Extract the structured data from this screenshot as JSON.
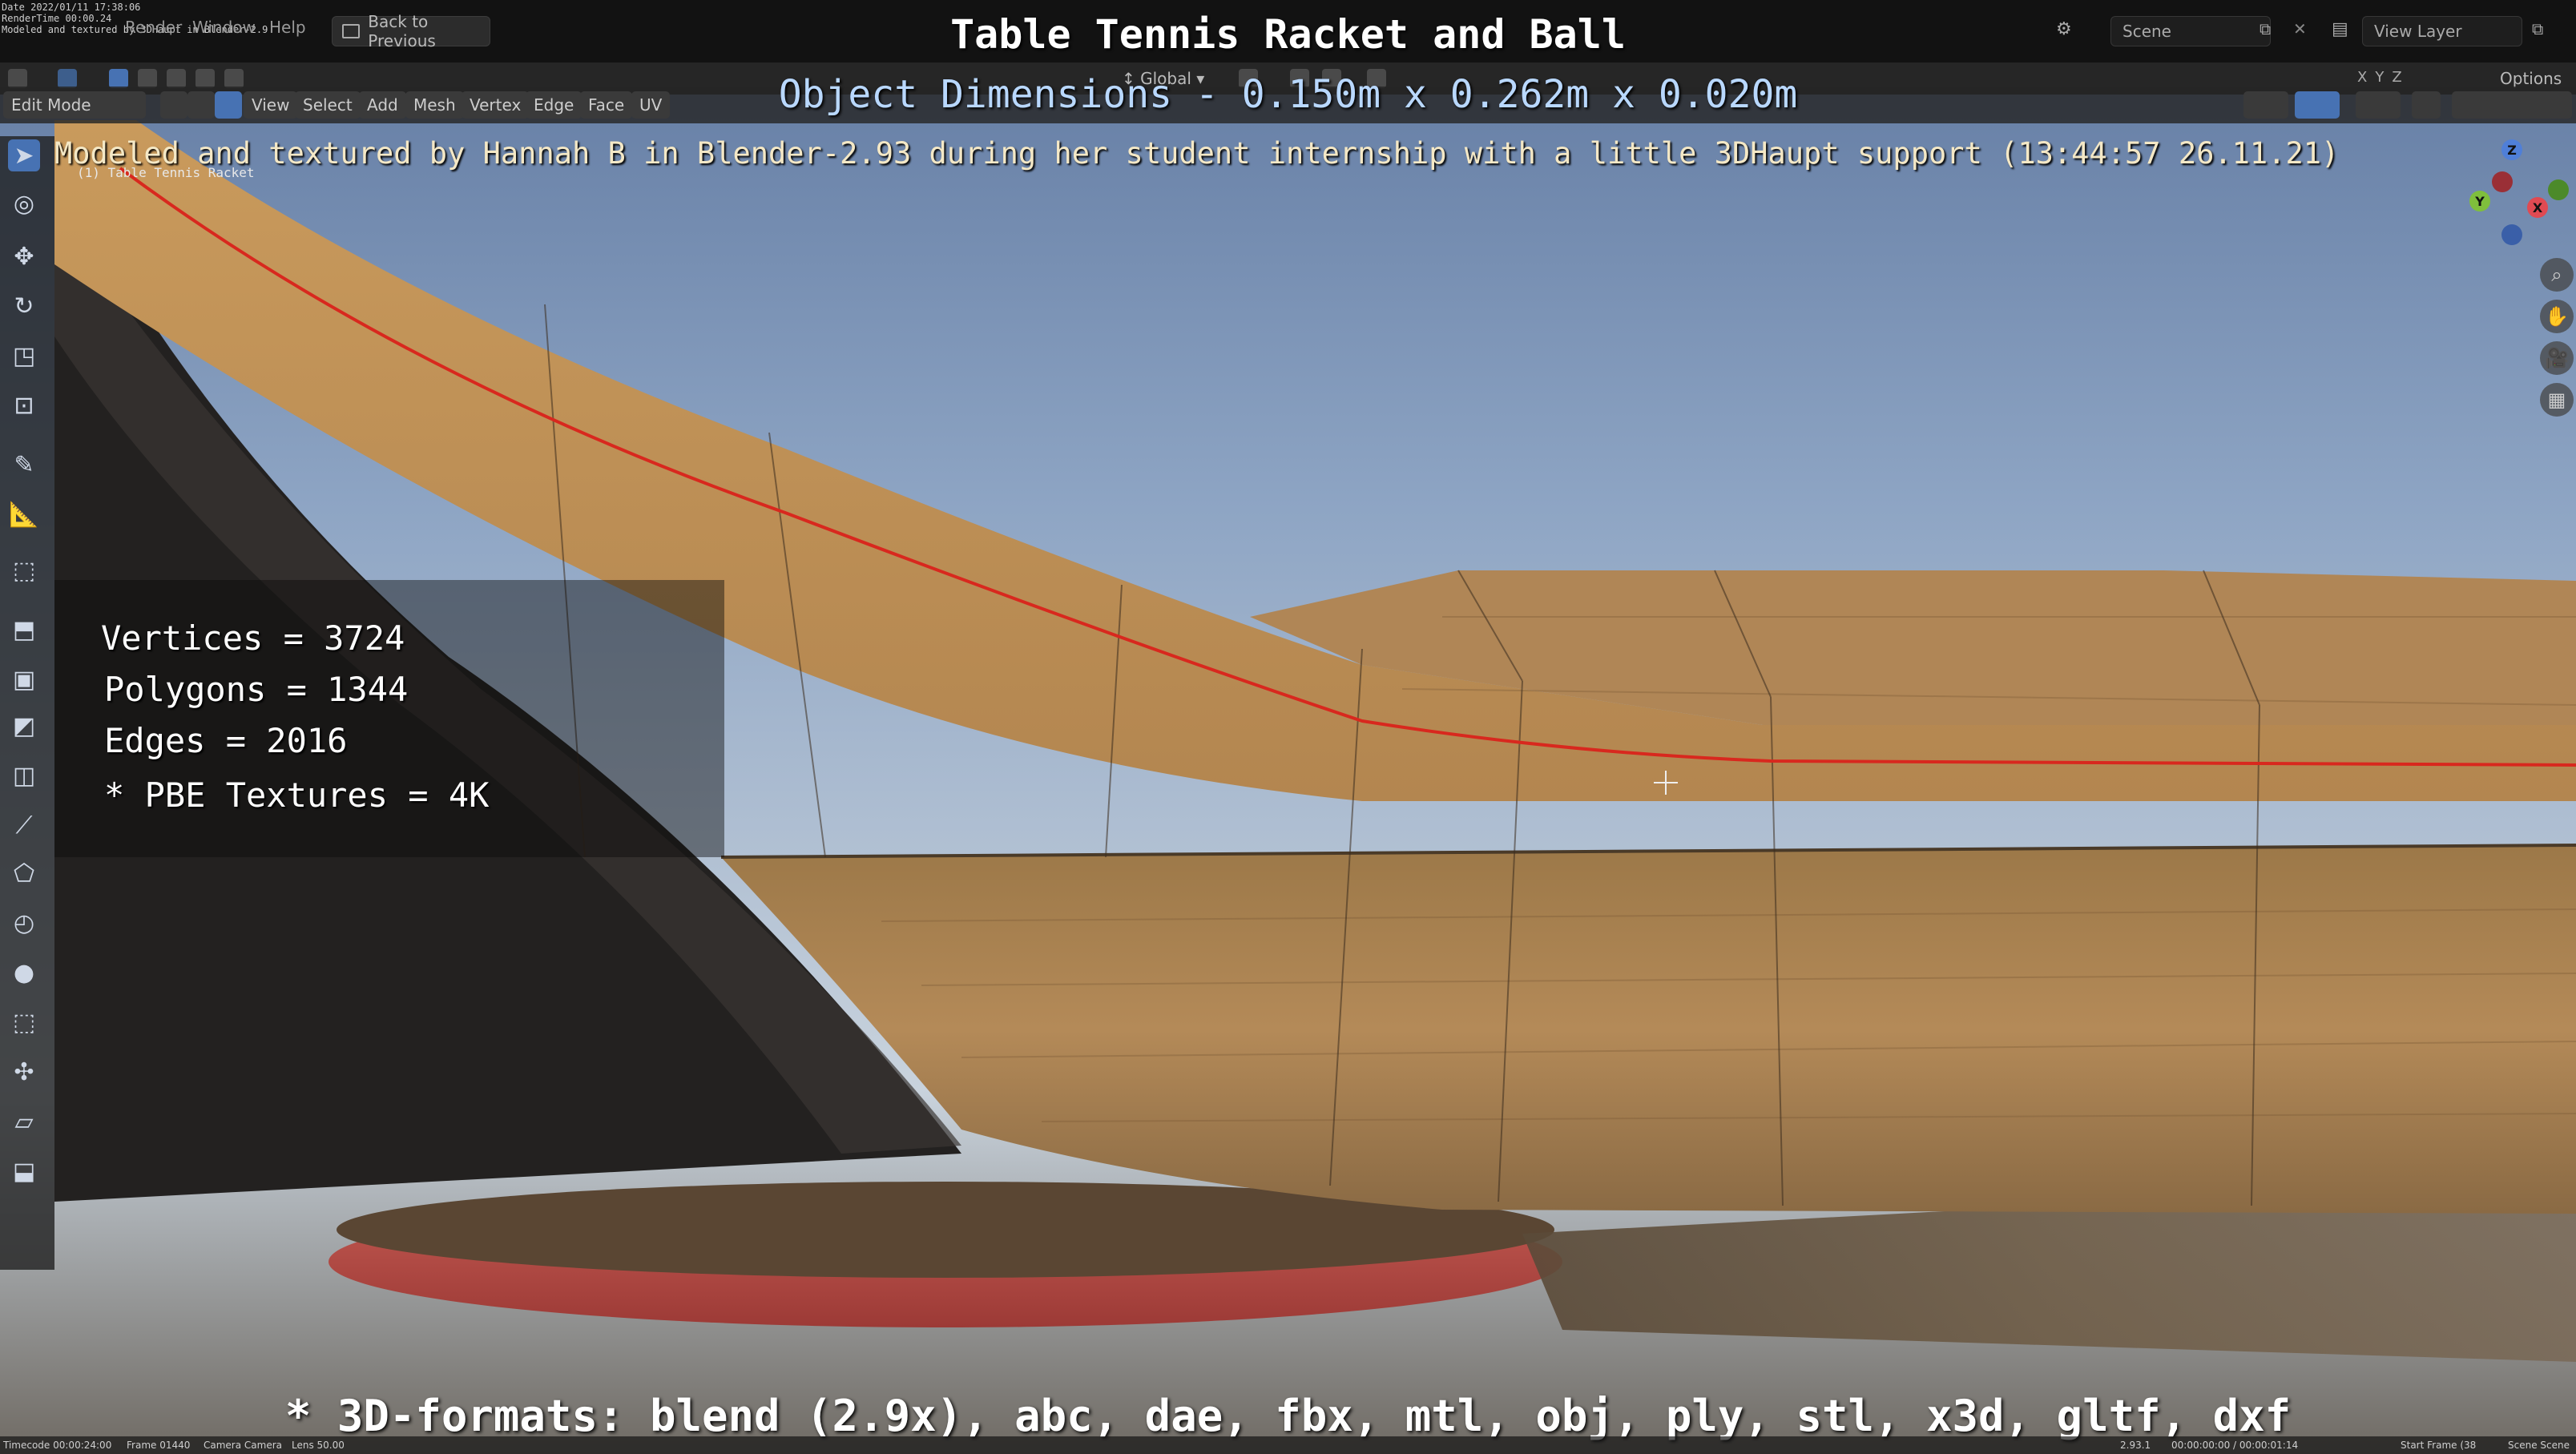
{
  "overlay": {
    "title": "Table Tennis Racket and Ball",
    "dimensions": "Object Dimensions -  0.150m x 0.262m x 0.020m",
    "credit": "Modeled and textured by Hannah B in Blender-2.93 during her student internship with a little 3DHaupt support (13:44:57 26.11.21)",
    "stats": {
      "vertices": "Vertices = 3724",
      "polygons": "Polygons = 1344",
      "edges": "Edges = 2016",
      "textures": "* PBE Textures = 4K"
    },
    "formats": "* 3D-formats: blend (2.9x), abc, dae, fbx, mtl, obj, ply, stl, x3d, gltf, dxf"
  },
  "stamp": {
    "date": "Date 2022/01/11 17:38:06",
    "rendertime": "RenderTime 00:00.24",
    "note": "Modeled and textured by 3DHaupt in Blender-2.9",
    "object_label": "(1) Table Tennis Racket"
  },
  "menu": {
    "render": "Render",
    "window": "Window",
    "help": "Help",
    "back": "Back to Previous"
  },
  "header_right": {
    "scene": "Scene",
    "view_layer": "View Layer"
  },
  "toolbar2": {
    "orientation": "Global",
    "options": "Options",
    "axes": [
      "X",
      "Y",
      "Z"
    ]
  },
  "modebar": {
    "mode": "Edit Mode",
    "menus": [
      "View",
      "Select",
      "Add",
      "Mesh",
      "Vertex",
      "Edge",
      "Face",
      "UV"
    ]
  },
  "statusbar": {
    "timecode": "Timecode 00:00:24:00",
    "frame": "Frame 01440",
    "camera": "Camera Camera",
    "lens": "Lens 50.00",
    "version": "2.93.1",
    "time": "00:00:00:00 / 00:00:01:14",
    "start_frame": "Start Frame (38",
    "scene": "Scene Scene"
  },
  "gizmo": {
    "z": "Z",
    "y": "Y",
    "x": "X"
  },
  "colors": {
    "accent_blue": "#4772b3",
    "edge_red": "#d8281e",
    "wood": "#c9a06a",
    "rubber_red": "#b3413c"
  }
}
